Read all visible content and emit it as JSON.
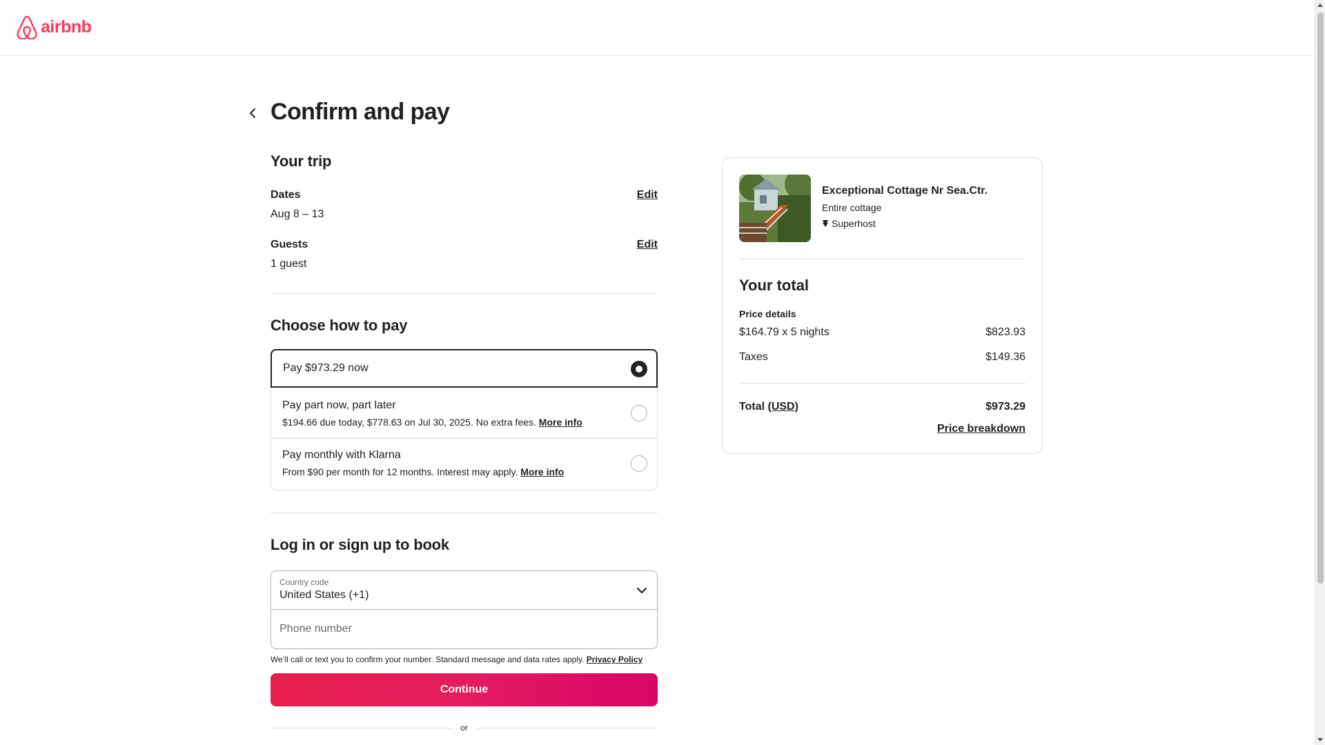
{
  "header": {
    "logo_text": "airbnb",
    "brand_color": "#ff385c"
  },
  "page": {
    "title": "Confirm and pay",
    "back_icon": "chevron-left-icon"
  },
  "trip": {
    "title": "Your trip",
    "dates_label": "Dates",
    "dates_value": "Aug 8 – 13",
    "guests_label": "Guests",
    "guests_value": "1 guest",
    "edit_label": "Edit"
  },
  "payment": {
    "title": "Choose how to pay",
    "options": [
      {
        "label": "Pay $973.29 now",
        "selected": true
      },
      {
        "label": "Pay part now, part later",
        "sub": "$194.66 due today, $778.63 on Jul 30, 2025. No extra fees.",
        "link": "More info",
        "selected": false
      },
      {
        "label": "Pay monthly with Klarna",
        "sub": "From $90 per month for 12 months. Interest may apply.",
        "link": "More info",
        "selected": false
      }
    ]
  },
  "login": {
    "title": "Log in or sign up to book",
    "country_label": "Country code",
    "country_value": "United States (+1)",
    "phone_placeholder": "Phone number",
    "legal_text": "We’ll call or text you to confirm your number. Standard message and data rates apply.",
    "privacy_link": "Privacy Policy",
    "continue_label": "Continue",
    "or_label": "or",
    "accent_color": "#e31c5f"
  },
  "listing": {
    "title": "Exceptional Cottage Nr Sea.Ctr.",
    "type": "Entire cottage",
    "badge": "Superhost",
    "badge_icon": "superhost-icon"
  },
  "totals": {
    "title": "Your total",
    "details_label": "Price details",
    "nights_label": "$164.79 x 5 nights",
    "nights_amount": "$823.93",
    "taxes_label": "Taxes",
    "taxes_amount": "$149.36",
    "total_label": "Total",
    "currency": "(USD)",
    "total_amount": "$973.29",
    "breakdown_label": "Price breakdown"
  }
}
